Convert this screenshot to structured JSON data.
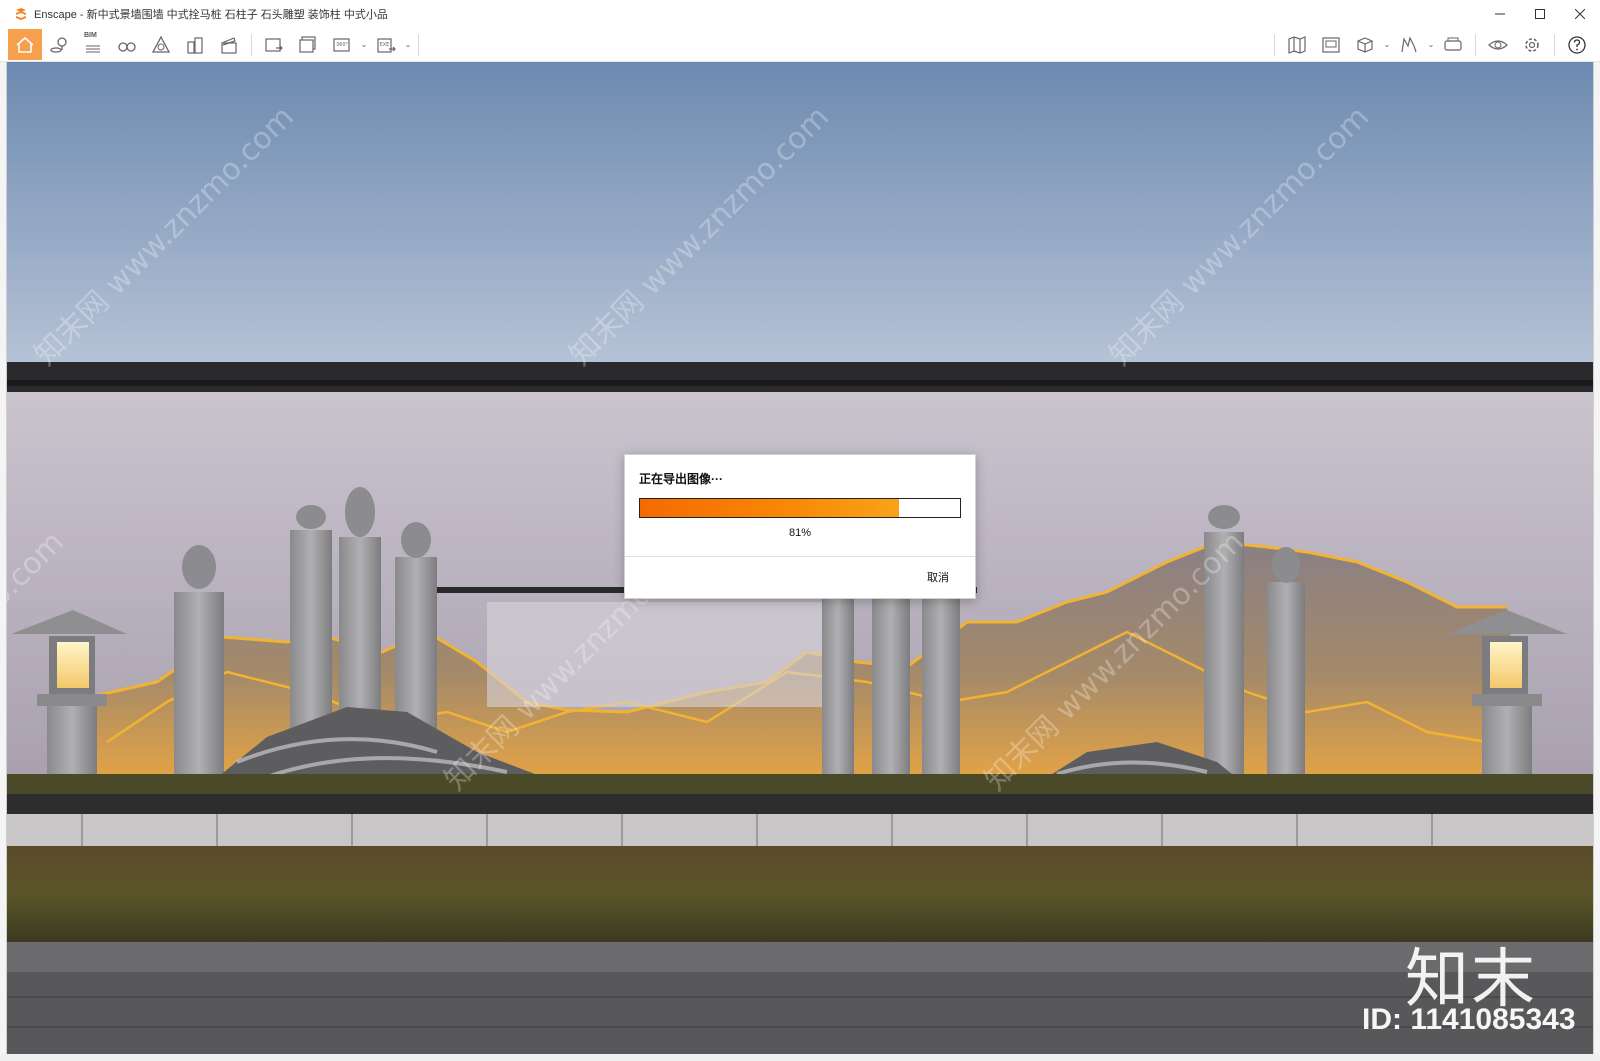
{
  "window": {
    "app_name": "Enscape",
    "title": "Enscape - 新中式景墙围墙 中式拴马桩 石柱子 石头雕塑 装饰柱 中式小品",
    "controls": [
      "minimize",
      "maximize",
      "close"
    ]
  },
  "toolbar": {
    "left_tools": [
      {
        "name": "home-icon",
        "active": true
      },
      {
        "name": "map-pin-icon"
      },
      {
        "name": "bim-icon",
        "label": "BIM"
      },
      {
        "name": "binoculars-icon"
      },
      {
        "name": "atmosphere-icon"
      },
      {
        "name": "buildings-icon"
      },
      {
        "name": "video-editor-icon"
      },
      {
        "name": "screenshot-icon"
      },
      {
        "name": "batch-render-icon"
      },
      {
        "name": "panorama-icon",
        "label": "360°",
        "dropdown": true
      },
      {
        "name": "export-icon",
        "label": "EXE",
        "dropdown": true
      }
    ],
    "right_tools": [
      {
        "name": "map-icon"
      },
      {
        "name": "views-icon"
      },
      {
        "name": "asset-library-icon",
        "dropdown": true
      },
      {
        "name": "material-editor-icon",
        "dropdown": true
      },
      {
        "name": "vr-headset-icon"
      },
      {
        "name": "visual-settings-icon"
      },
      {
        "name": "settings-gear-icon"
      },
      {
        "name": "help-icon"
      }
    ]
  },
  "viewport": {
    "watermark_brand": "知末",
    "watermark_id": "ID: 1141085343",
    "watermark_diagonal": "知末网 www.znzmo.com"
  },
  "dialog": {
    "title": "正在导出图像···",
    "progress_percent": 81,
    "progress_text": "81%",
    "cancel_label": "取消"
  },
  "colors": {
    "accent": "#f6a04d",
    "progress_orange": "#f56a00",
    "sky_top": "#6f8db3",
    "wall": "#b8b2bd"
  }
}
